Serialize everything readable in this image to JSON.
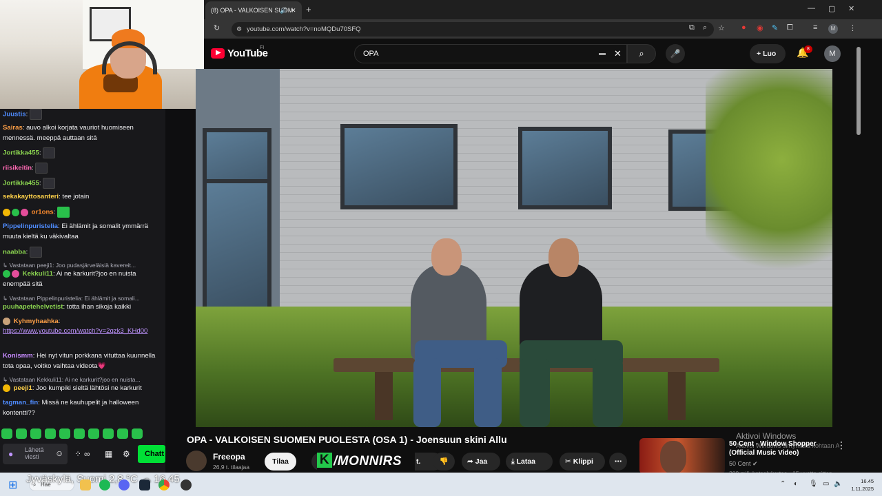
{
  "chat": {
    "messages": [
      {
        "user": "Juustis",
        "color": "#4f8cff",
        "text": "",
        "emote": true
      },
      {
        "user": "Sairas",
        "color": "#ffa047",
        "text": "auvo alkoi korjata vauriot huomiseen mennessä. meeppä auttaan sitä"
      },
      {
        "user": "Jortikka455",
        "color": "#8bd450",
        "text": "",
        "emote": true
      },
      {
        "user": "riisikeitin",
        "color": "#ff69b4",
        "text": "",
        "emote": true
      },
      {
        "user": "Jortikka455",
        "color": "#8bd450",
        "text": "",
        "emote": true
      },
      {
        "user": "sekakayttosanteri",
        "color": "#ffd24a",
        "text": "tee jotain"
      },
      {
        "user": "or1ons",
        "color": "#ff8c2e",
        "text": "",
        "emote": true
      },
      {
        "user": "Pippelinpuristelia",
        "color": "#4f8cff",
        "text": "Ei ählämit ja somalit ymmärrä muuta kieltä ku väkivaltaa"
      },
      {
        "user": "naabba",
        "color": "#8bd450",
        "text": "",
        "emote": true
      },
      {
        "reply": "Vastataan peeji1: Joo pudasjärveläisiä kavereit..."
      },
      {
        "user": "Kekkuli11",
        "color": "#8bd450",
        "text": "Ai ne karkurit?joo en nuista enempää sitä"
      },
      {
        "reply": "Vastataan Pippelinpuristelia: Ei ählämit ja somali..."
      },
      {
        "user": "puuhapetehelvetist",
        "color": "#8bd450",
        "text": "totta ihan sikoja kaikki"
      },
      {
        "user": "Kyhmyhaahka",
        "color": "#ffa047",
        "text": ""
      },
      {
        "link": "https://www.youtube.com/watch?v=2qzk3_KHd00"
      },
      {
        "user": "Konismm",
        "color": "#c78bff",
        "text": "Hei nyt vitun porkkana vituttaa kuunnella tota opaa, voitko vaihtaa videota💗"
      },
      {
        "reply": "Vastataan Kekkuli11: Ai ne karkurit?joo en nuista..."
      },
      {
        "user": "peeji1",
        "color": "#ffd24a",
        "text": "Joo kumpiki sieltä lähtösi ne karkurit"
      },
      {
        "user": "tagman_fin",
        "color": "#4f8cff",
        "text": "Missä ne kauhupelit ja halloween kontentti??"
      }
    ],
    "input_placeholder": "Lähetä viesti",
    "chat_button": "Chatt",
    "infinity": "∞",
    "icons": [
      "mic-icon",
      "emote-picker-icon",
      "points-icon",
      "store-icon",
      "settings-icon"
    ]
  },
  "browser": {
    "tab_title": "(8) OPA - VALKOISEN SUOM",
    "url": "youtube.com/watch?v=noMQDu70SFQ"
  },
  "youtube": {
    "logo": "YouTube",
    "region": "FI",
    "search_query": "OPA",
    "create_label": "Luo",
    "notification_count": "8",
    "avatar_letter": "M",
    "video_title": "OPA - VALKOISEN SUOMEN PUOLESTA (OSA 1) - Joensuun skini Allu",
    "channel_name": "Freeopa",
    "subscribers": "26,9 t. tilaajaa",
    "subscribe_label": "Tilaa",
    "like_count": "t.",
    "share_label": "Jaa",
    "download_label": "Lataa",
    "clip_label": "Klippi",
    "overlay_brand": "/MONNIRS",
    "overlay_letter": "K",
    "recommendation": {
      "title": "50 Cent - Window Shopper (Official Music Video)",
      "channel": "50 Cent",
      "meta": "309 milj. katselukertaa · 15 vuotta sitten"
    },
    "watermark_title": "Aktivoi Windows",
    "watermark_sub": "Aktivoi Windows siirtymällä kohtaan Asetukset."
  },
  "taskbar": {
    "weather": "Jyväskylä, Suomi 2,8 °C",
    "weather_time": "16.45",
    "search_label": "Hae",
    "time": "16.45",
    "date": "1.11.2025"
  }
}
